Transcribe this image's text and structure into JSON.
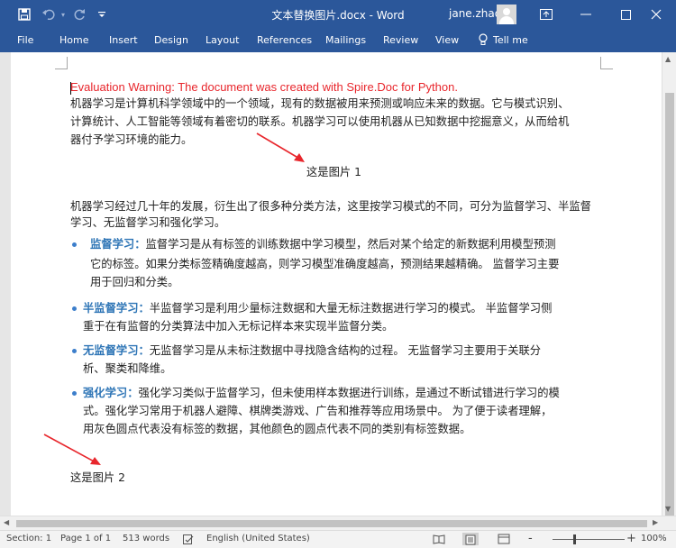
{
  "window": {
    "title": "文本替换图片.docx  -  Word",
    "user": "jane.zhao"
  },
  "ribbon": {
    "tabs": [
      "File",
      "Home",
      "Insert",
      "Design",
      "Layout",
      "References",
      "Mailings",
      "Review",
      "View"
    ],
    "tell_me": "Tell me"
  },
  "document": {
    "warning": "Evaluation Warning: The document was created with Spire.Doc for Python.",
    "para1": [
      "机器学习是计算机科学领域中的一个领域，现有的数据被用来预测或响应未来的数据。它与模式识别、",
      "计算统计、人工智能等领域有着密切的联系。机器学习可以使用机器从已知数据中挖掘意义，从而给机",
      "器付予学习环境的能力。"
    ],
    "image1_text": "这是图片  1",
    "para2": [
      "机器学习经过几十年的发展，衍生出了很多种分类方法，这里按学习模式的不同，可分为监督学习、半监督",
      "学习、无监督学习和强化学习。"
    ],
    "bullets": [
      {
        "term": "监督学习：",
        "lines": [
          "监督学习是从有标签的训练数据中学习模型，然后对某个给定的新数据利用模型预测",
          "它的标签。如果分类标签精确度越高，则学习模型准确度越高，预测结果越精确。  监督学习主要",
          "用于回归和分类。"
        ]
      },
      {
        "term": "半监督学习：",
        "lines": [
          "半监督学习是利用少量标注数据和大量无标注数据进行学习的模式。  半监督学习侧",
          "重于在有监督的分类算法中加入无标记样本来实现半监督分类。"
        ]
      },
      {
        "term": "无监督学习：",
        "lines": [
          "无监督学习是从未标注数据中寻找隐含结构的过程。  无监督学习主要用于关联分",
          "析、聚类和降维。"
        ]
      },
      {
        "term": "强化学习：",
        "lines": [
          "强化学习类似于监督学习，但未使用样本数据进行训练，是通过不断试错进行学习的模",
          "式。强化学习常用于机器人避障、棋牌类游戏、广告和推荐等应用场景中。  为了便于读者理解，",
          "用灰色圆点代表没有标签的数据，其他颜色的圆点代表不同的类别有标签数据。"
        ]
      }
    ],
    "image2_text": "这是图片  2"
  },
  "status": {
    "section": "Section: 1",
    "page": "Page 1 of 1",
    "words": "513 words",
    "language": "English (United States)",
    "zoom": "100%",
    "zoom_minus": "-",
    "zoom_plus": "+"
  },
  "colors": {
    "ribbon": "#2b579a",
    "warning": "#e8262c",
    "term": "#2e75b6",
    "arrow": "#e8262c"
  }
}
